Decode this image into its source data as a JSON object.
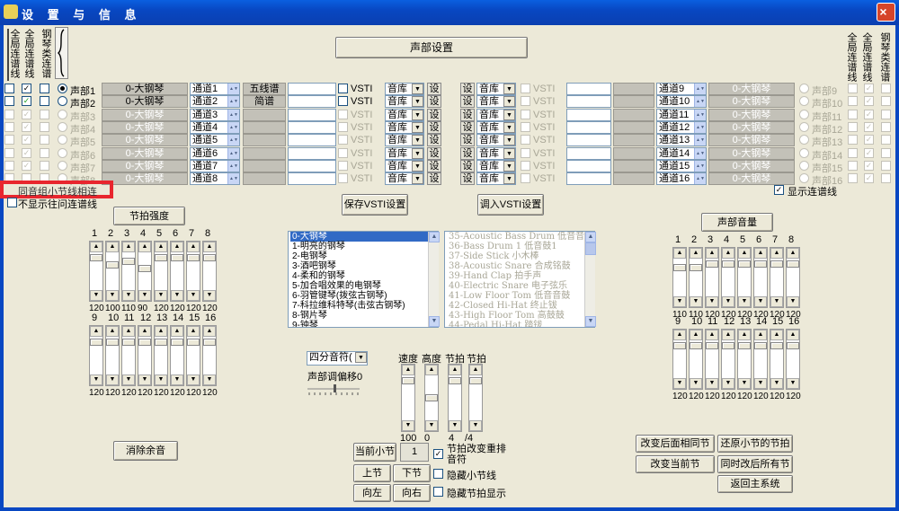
{
  "window": {
    "title": "设 置 与 信 息",
    "close": "×"
  },
  "header": {
    "left_tabs": [
      "全局连谱线",
      "全局连谱线",
      "钢琴类连谱"
    ],
    "right_tabs": [
      "全局连谱线",
      "全局连谱线",
      "钢琴类连谱"
    ],
    "voice_settings_btn": "声部设置"
  },
  "voices_left": [
    {
      "name": "声部1",
      "instr": "0-大钢琴",
      "ch": "通道1",
      "mode": "五线谱",
      "enabled": true
    },
    {
      "name": "声部2",
      "instr": "0-大钢琴",
      "ch": "通道2",
      "mode": "简谱",
      "enabled": true
    },
    {
      "name": "声部3",
      "instr": "0-大钢琴",
      "ch": "通道3",
      "mode": "",
      "enabled": false
    },
    {
      "name": "声部4",
      "instr": "0-大钢琴",
      "ch": "通道4",
      "mode": "",
      "enabled": false
    },
    {
      "name": "声部5",
      "instr": "0-大钢琴",
      "ch": "通道5",
      "mode": "",
      "enabled": false
    },
    {
      "name": "声部6",
      "instr": "0-大钢琴",
      "ch": "通道6",
      "mode": "",
      "enabled": false
    },
    {
      "name": "声部7",
      "instr": "0-大钢琴",
      "ch": "通道7",
      "mode": "",
      "enabled": false
    },
    {
      "name": "声部8",
      "instr": "0-大钢琴",
      "ch": "通道8",
      "mode": "",
      "enabled": false
    }
  ],
  "voices_right": [
    {
      "name": "声部9",
      "instr": "0-大钢琴",
      "ch": "通道9"
    },
    {
      "name": "声部10",
      "instr": "0-大钢琴",
      "ch": "通道10"
    },
    {
      "name": "声部11",
      "instr": "0-大钢琴",
      "ch": "通道11"
    },
    {
      "name": "声部12",
      "instr": "0-大钢琴",
      "ch": "通道12"
    },
    {
      "name": "声部13",
      "instr": "0-大钢琴",
      "ch": "通道13"
    },
    {
      "name": "声部14",
      "instr": "0-大钢琴",
      "ch": "通道14"
    },
    {
      "name": "声部15",
      "instr": "0-大钢琴",
      "ch": "通道15"
    },
    {
      "name": "声部16",
      "instr": "0-大钢琴",
      "ch": "通道16"
    }
  ],
  "vsti_label": "VSTI",
  "lib_label": "音库",
  "set_label": "设",
  "options": {
    "same_group_link": "同音组小节线相连",
    "no_show_link": "不显示往问连谱线",
    "show_link": "显示连谱线"
  },
  "buttons": {
    "save_vsti": "保存VSTI设置",
    "load_vsti": "调入VSTI设置",
    "beat_strength": "节拍强度",
    "voice_volume": "声部音量",
    "clear_sound": "消除余音",
    "current_bar": "当前小节",
    "prev_bar": "上节",
    "next_bar": "下节",
    "left": "向左",
    "right": "向右",
    "change_after": "改变后面相同节",
    "restore_beats": "还原小节的节拍",
    "change_current": "改变当前节",
    "change_all": "同时改后所有节",
    "return_main": "返回主系统"
  },
  "beat": {
    "top_nums": [
      "1",
      "2",
      "3",
      "4",
      "5",
      "6",
      "7",
      "8"
    ],
    "top_vals": [
      "120",
      "100",
      "110",
      "90",
      "120",
      "120",
      "120",
      "120"
    ],
    "bottom_nums": [
      "9",
      "10",
      "11",
      "12",
      "13",
      "14",
      "15",
      "16"
    ],
    "bottom_vals": [
      "120",
      "120",
      "120",
      "120",
      "120",
      "120",
      "120",
      "120"
    ]
  },
  "volume": {
    "top_nums": [
      "1",
      "2",
      "3",
      "4",
      "5",
      "6",
      "7",
      "8"
    ],
    "top_vals": [
      "110",
      "110",
      "120",
      "120",
      "120",
      "120",
      "120",
      "120"
    ],
    "bottom_nums": [
      "9",
      "10",
      "11",
      "12",
      "13",
      "14",
      "15",
      "16"
    ],
    "bottom_vals": [
      "120",
      "120",
      "120",
      "120",
      "120",
      "120",
      "120",
      "120"
    ]
  },
  "instrument_list": [
    "0-大钢琴",
    "1-明亮的钢琴",
    "2-电钢琴",
    "3-酒吧钢琴",
    "4-柔和的钢琴",
    "5-加合唱效果的电钢琴",
    "6-羽管键琴(拨弦古钢琴)",
    "7-科拉维科特琴(击弦古钢琴)",
    "8-钢片琴",
    "9-钟琴"
  ],
  "drum_list": [
    "35-Acoustic Bass Drum 低音音",
    "36-Bass Drum 1 低音鼓1",
    "37-Side Stick 小木棒",
    "38-Acoustic Snare 合成铭鼓",
    "39-Hand Clap 拍手声",
    "40-Electric Snare 电子弦乐",
    "41-Low Floor Tom 低音音鼓",
    "42-Closed Hi-Hat 终止钹",
    "43-High Floor Tom 高鼓鼓",
    "44-Pedal Hi-Hat 踏钹"
  ],
  "note_combo": "四分音符(",
  "pitch_offset": "声部调偏移0",
  "tempo": {
    "speed_label": "速度",
    "height_label": "高度",
    "beat_label": "节拍",
    "beat2_label": "节拍",
    "speed_val": "100",
    "height_val": "0",
    "beats_val": "4",
    "beat_unit": "/4"
  },
  "current_bar_value": "1",
  "checks": {
    "beat_change": "节拍改变重排音符",
    "hide_bar": "隐藏小节线",
    "hide_beat": "隐藏节拍显示"
  }
}
